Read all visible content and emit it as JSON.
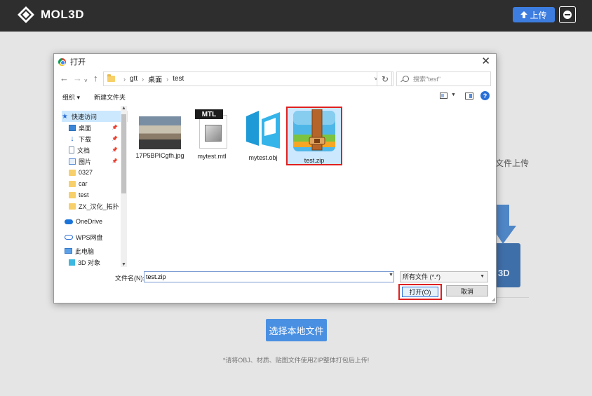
{
  "app": {
    "logo_text": "MOL3D",
    "upload_label": "上传",
    "page_side_text": "文件上传",
    "page_side_icon_text": "3D",
    "choose_local_file": "选择本地文件",
    "note": "*请将OBJ、材质、贴图文件使用ZIP整体打包后上传!",
    "colors": {
      "header_bg": "#2e2e2e",
      "accent": "#3d7de0",
      "choose_btn": "#4a90e2"
    }
  },
  "dialog": {
    "title": "打开",
    "close_glyph": "✕",
    "breadcrumbs": [
      "gtt",
      "桌面",
      "test"
    ],
    "search_placeholder": "搜索\"test\"",
    "toolbar": {
      "organize": "组织 ▾",
      "new_folder": "新建文件夹",
      "help": "?"
    },
    "nav_items": [
      {
        "label": "快速访问",
        "icon": "star-icon"
      },
      {
        "label": "桌面",
        "icon": "desktop-icon",
        "pinned": true
      },
      {
        "label": "下载",
        "icon": "download-icon",
        "pinned": true
      },
      {
        "label": "文档",
        "icon": "document-icon",
        "pinned": true
      },
      {
        "label": "图片",
        "icon": "picture-icon",
        "pinned": true
      },
      {
        "label": "0327",
        "icon": "folder-icon"
      },
      {
        "label": "car",
        "icon": "folder-icon"
      },
      {
        "label": "test",
        "icon": "folder-icon"
      },
      {
        "label": "ZX_汉化_拓扑（",
        "icon": "folder-icon"
      },
      {
        "label": "OneDrive",
        "icon": "cloud-icon"
      },
      {
        "label": "WPS网盘",
        "icon": "wps-cloud-icon"
      },
      {
        "label": "此电脑",
        "icon": "computer-icon"
      },
      {
        "label": "3D 对象",
        "icon": "3d-objects-icon"
      }
    ],
    "files": [
      {
        "name": "17P5BPICgfh.jpg",
        "type": "jpg"
      },
      {
        "name": "mytest.mtl",
        "type": "mtl",
        "badge": "MTL"
      },
      {
        "name": "mytest.obj",
        "type": "obj"
      },
      {
        "name": "test.zip",
        "type": "zip",
        "selected": true
      }
    ],
    "file_name_label": "文件名(N):",
    "file_name_value": "test.zip",
    "file_type_value": "所有文件 (*.*)",
    "open_label": "打开(O)",
    "cancel_label": "取消"
  }
}
